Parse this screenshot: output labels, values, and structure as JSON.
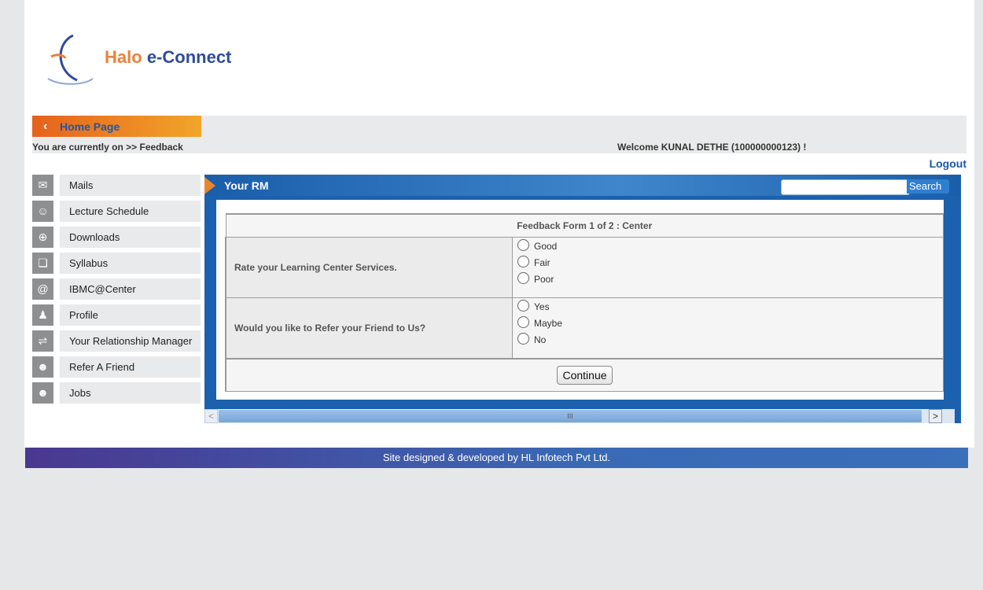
{
  "logo": {
    "text_a": "Halo",
    "text_b": "e-Connect"
  },
  "nav": {
    "home_label": "Home Page",
    "breadcrumb": "You are currently on >> Feedback",
    "welcome": "Welcome KUNAL DETHE (100000000123) !",
    "logout": "Logout"
  },
  "sidebar": {
    "items": [
      {
        "label": "Mails",
        "icon": "mail-icon"
      },
      {
        "label": "Lecture Schedule",
        "icon": "group-icon"
      },
      {
        "label": "Downloads",
        "icon": "download-icon"
      },
      {
        "label": "Syllabus",
        "icon": "documents-icon"
      },
      {
        "label": "IBMC@Center",
        "icon": "at-icon"
      },
      {
        "label": "Profile",
        "icon": "profile-icon"
      },
      {
        "label": "Your Relationship Manager",
        "icon": "handshake-icon"
      },
      {
        "label": "Refer A Friend",
        "icon": "people-icon"
      },
      {
        "label": "Jobs",
        "icon": "people-icon"
      }
    ]
  },
  "panel": {
    "title": "Your RM",
    "search_value": "",
    "search_button": "Search"
  },
  "form": {
    "header": "Feedback Form 1 of 2 : Center",
    "questions": [
      {
        "text": "Rate your Learning Center Services.",
        "options": [
          "Good",
          "Fair",
          "Poor"
        ]
      },
      {
        "text": "Would you like to Refer your Friend to Us?",
        "options": [
          "Yes",
          "Maybe",
          "No"
        ]
      }
    ],
    "submit": "Continue"
  },
  "scrollbar": {
    "left": "<",
    "thumb": "III",
    "right": ">"
  },
  "footer": {
    "text": "Site designed & developed by HL Infotech Pvt Ltd."
  }
}
